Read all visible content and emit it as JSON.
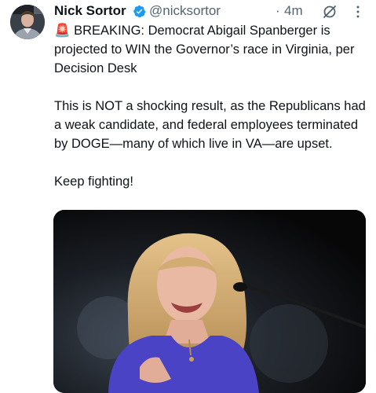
{
  "tweet": {
    "author_name": "Nick Sortor",
    "handle": "@nicksortor",
    "separator": "·",
    "time": "4m",
    "verified_icon": "verified-badge-icon",
    "paragraphs": [
      "🚨 BREAKING: Democrat Abigail Spanberger is projected to WIN the Governor’s race in Virginia, per Decision Desk",
      "This is NOT a shocking result, as the Republicans had a weak candidate, and federal employees terminated by DOGE—many of which live in VA—are upset.",
      "Keep fighting!"
    ],
    "media": {
      "type": "photo",
      "description_icon": "speaker-photo"
    }
  },
  "colors": {
    "text": "#0f1419",
    "secondary": "#536471",
    "verified": "#1d9bf0"
  }
}
